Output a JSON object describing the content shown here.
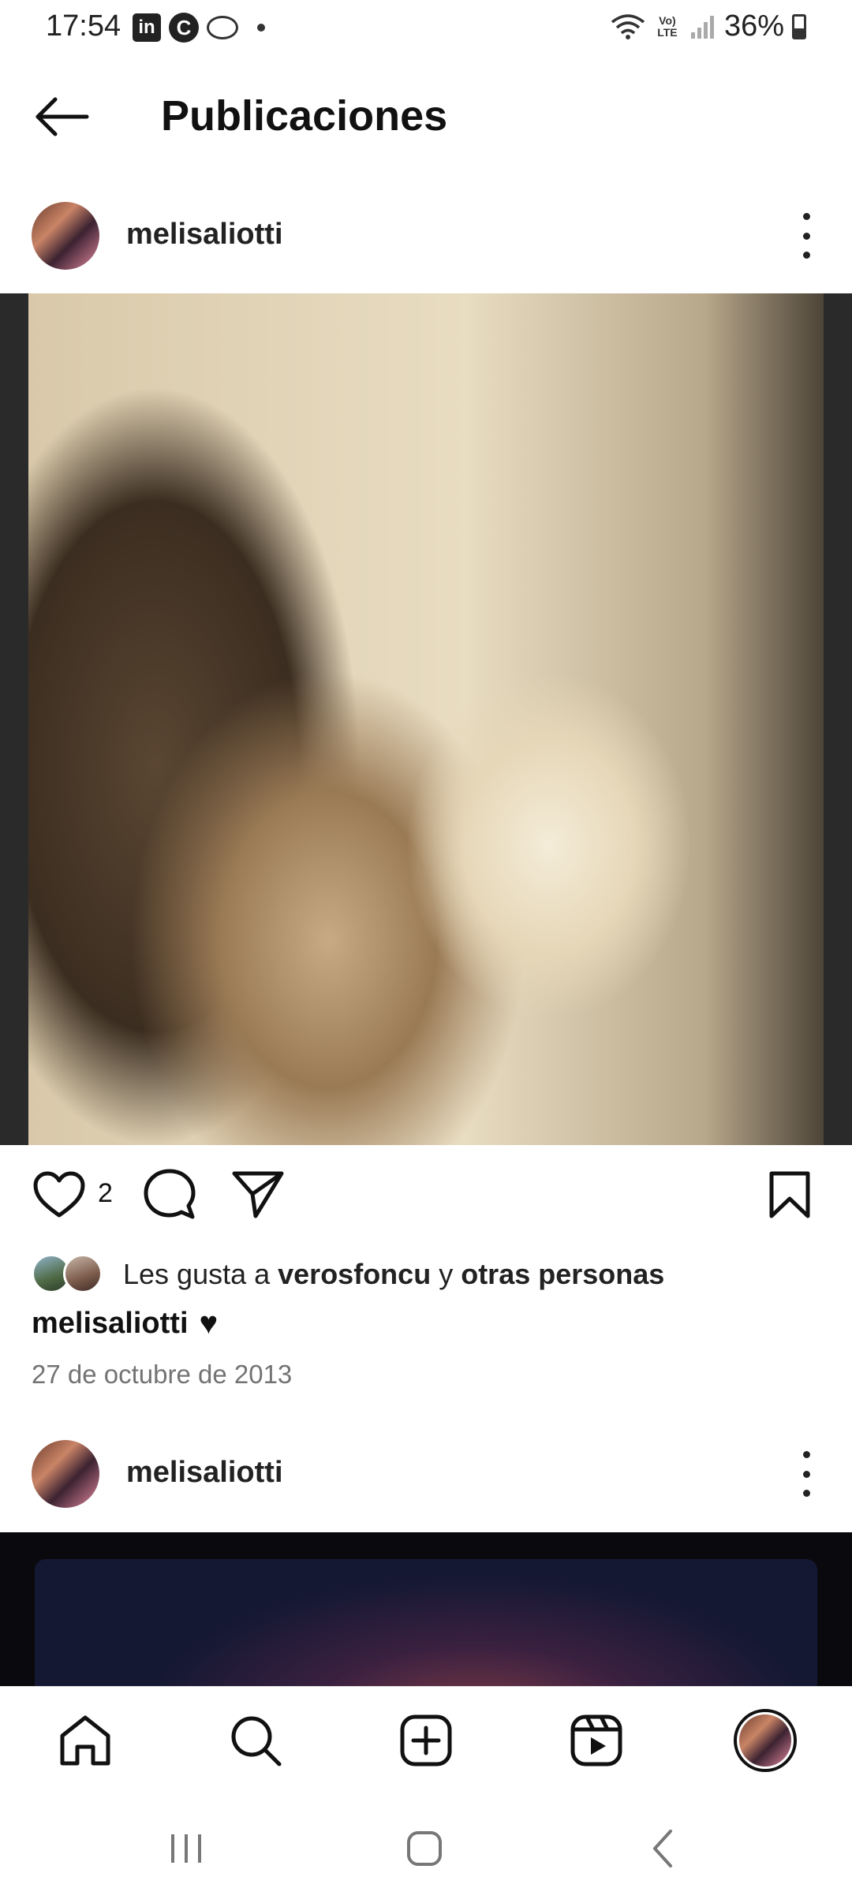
{
  "status_bar": {
    "time": "17:54",
    "app_icons": [
      "linkedin-icon",
      "c-icon",
      "misc-icon"
    ],
    "battery": "36%",
    "network": "Vo) LTE"
  },
  "header": {
    "title": "Publicaciones"
  },
  "posts": [
    {
      "username": "melisaliotti",
      "like_count": "2",
      "likes_prefix": "Les gusta a ",
      "likes_user": "verosfoncu",
      "likes_join": " y ",
      "likes_others": "otras personas",
      "caption_user": "melisaliotti",
      "caption_text": "♥",
      "date": "27 de octubre de 2013"
    },
    {
      "username": "melisaliotti"
    }
  ],
  "bottom_nav": [
    "home-icon",
    "search-icon",
    "create-icon",
    "reels-icon",
    "profile-avatar"
  ],
  "colors": {
    "text": "#111111",
    "secondary_text": "#737373",
    "background": "#ffffff"
  }
}
